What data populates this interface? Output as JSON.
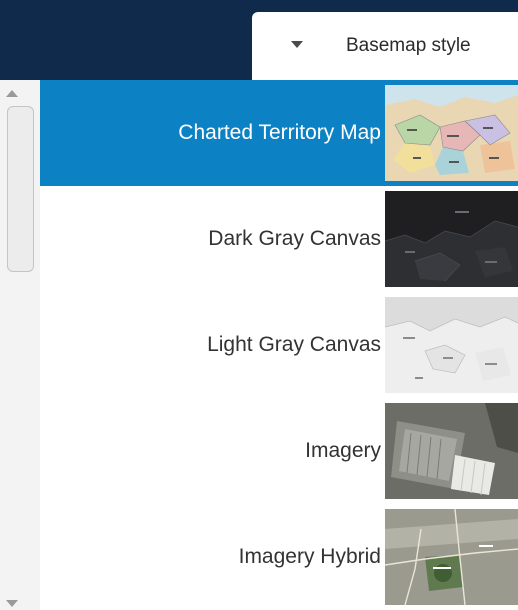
{
  "header": {
    "dropdown_label": "Basemap style",
    "dropdown_icon": "caret-down-icon",
    "background_color": "#0f2a4b"
  },
  "scrollbar": {
    "up_icon": "chevron-up-icon",
    "down_icon": "chevron-down-icon"
  },
  "basemaps": [
    {
      "label": "Charted Territory Map",
      "selected": true,
      "thumbnail": "charted-territory-thumbnail"
    },
    {
      "label": "Dark Gray Canvas",
      "selected": false,
      "thumbnail": "dark-gray-canvas-thumbnail"
    },
    {
      "label": "Light Gray Canvas",
      "selected": false,
      "thumbnail": "light-gray-canvas-thumbnail"
    },
    {
      "label": "Imagery",
      "selected": false,
      "thumbnail": "imagery-thumbnail"
    },
    {
      "label": "Imagery Hybrid",
      "selected": false,
      "thumbnail": "imagery-hybrid-thumbnail"
    }
  ],
  "colors": {
    "selected_background": "#0c82c5",
    "selected_text": "#ffffff",
    "text": "#333333"
  }
}
